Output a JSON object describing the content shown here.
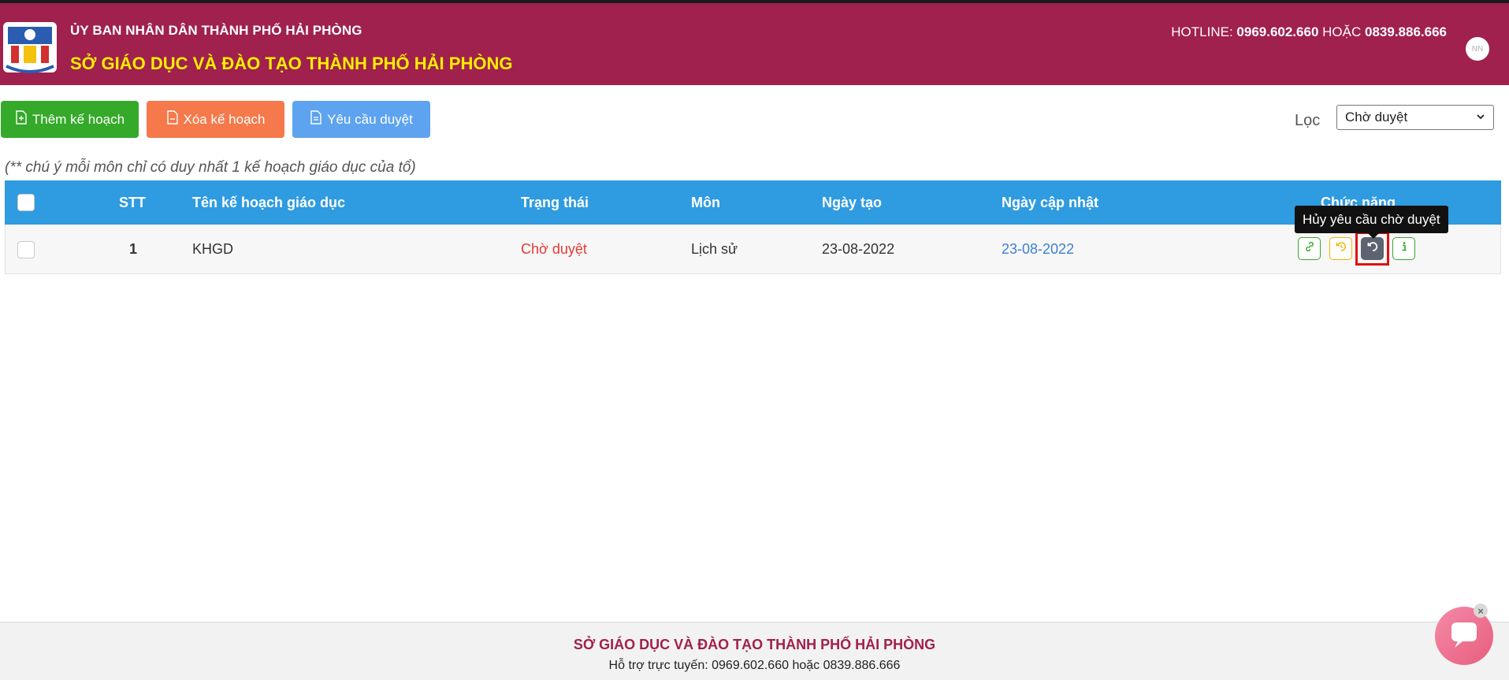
{
  "header": {
    "org_top": "ỦY BAN NHÂN DÂN THÀNH PHỐ HẢI PHÒNG",
    "org_main": "SỞ GIÁO DỤC VÀ ĐÀO TẠO THÀNH PHỐ HẢI PHÒNG",
    "hotline_label": "HOTLINE:",
    "hotline_1": "0969.602.660",
    "hotline_or": "HOẶC",
    "hotline_2": "0839.886.666",
    "avatar_initials": "NN"
  },
  "toolbar": {
    "add_label": "Thêm kế hoạch",
    "delete_label": "Xóa kế hoạch",
    "request_label": "Yêu cầu duyệt",
    "filter_label": "Lọc",
    "filter_value": "Chờ duyệt"
  },
  "note": "(** chú ý mỗi môn chỉ có duy nhất 1 kế hoạch giáo dục của tổ)",
  "table": {
    "headers": {
      "stt": "STT",
      "name": "Tên kế hoạch giáo dục",
      "status": "Trạng thái",
      "subject": "Môn",
      "created": "Ngày tạo",
      "updated": "Ngày cập nhật",
      "actions": "Chức năng"
    },
    "rows": [
      {
        "stt": "1",
        "name": "KHGD",
        "status": "Chờ duyệt",
        "subject": "Lịch sử",
        "created": "23-08-2022",
        "updated": "23-08-2022"
      }
    ]
  },
  "tooltip": "Hủy yêu cầu chờ duyệt",
  "footer": {
    "title": "SỞ GIÁO DỤC VÀ ĐÀO TẠO THÀNH PHỐ HẢI PHÒNG",
    "support": "Hỗ trợ trực tuyến: 0969.602.660 hoặc 0839.886.666"
  },
  "colors": {
    "header_bg": "#a0204e",
    "header_title": "#ffee00",
    "table_header": "#2f9be0",
    "btn_add": "#35a929",
    "btn_delete": "#f5794a",
    "btn_request": "#5da3ef",
    "status_pending": "#e53935"
  },
  "icons": [
    "logo-icon",
    "file-plus-icon",
    "file-delete-icon",
    "file-send-icon",
    "chevron-down-icon",
    "link-icon",
    "undo-icon",
    "cancel-request-icon",
    "info-icon",
    "chat-icon",
    "close-icon"
  ]
}
